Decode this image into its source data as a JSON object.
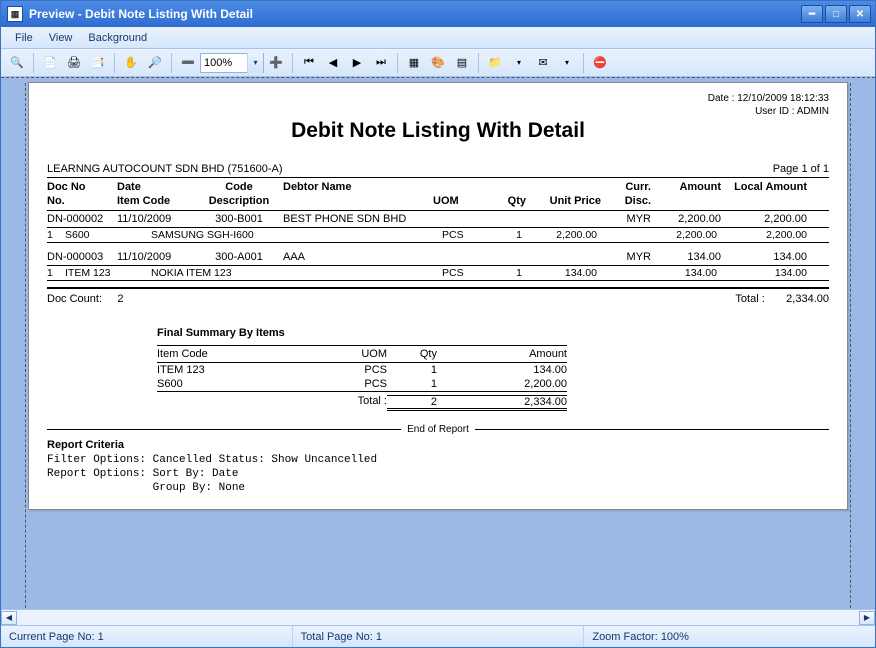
{
  "window": {
    "title": "Preview - Debit Note Listing With Detail"
  },
  "menu": {
    "file": "File",
    "view": "View",
    "background": "Background"
  },
  "toolbar": {
    "zoom_value": "100%"
  },
  "report": {
    "meta_date_label": "Date :",
    "meta_date": "12/10/2009 18:12:33",
    "meta_user_label": "User ID :",
    "meta_user": "ADMIN",
    "title": "Debit Note Listing With Detail",
    "org_name": "LEARNNG AUTOCOUNT SDN BHD (751600-A)",
    "page_label": "Page 1 of 1",
    "head": {
      "docno": "Doc No",
      "date": "Date",
      "code": "Code",
      "debtor": "Debtor Name",
      "curr": "Curr.",
      "amount": "Amount",
      "localamount": "Local Amount",
      "no": "No.",
      "itemcode": "Item Code",
      "description": "Description",
      "uom": "UOM",
      "qty": "Qty",
      "unitprice": "Unit Price",
      "disc": "Disc."
    },
    "docs": [
      {
        "docno": "DN-000002",
        "date": "11/10/2009",
        "code": "300-B001",
        "debtor": "BEST PHONE SDN BHD",
        "curr": "MYR",
        "amount": "2,200.00",
        "localamount": "2,200.00",
        "item_no": "1",
        "item_code": "S600",
        "item_desc": "SAMSUNG SGH-I600",
        "item_uom": "PCS",
        "item_qty": "1",
        "item_unitprice": "2,200.00",
        "item_disc": "",
        "item_amount": "2,200.00",
        "item_localamount": "2,200.00"
      },
      {
        "docno": "DN-000003",
        "date": "11/10/2009",
        "code": "300-A001",
        "debtor": "AAA",
        "curr": "MYR",
        "amount": "134.00",
        "localamount": "134.00",
        "item_no": "1",
        "item_code": "ITEM 123",
        "item_desc": "NOKIA ITEM 123",
        "item_uom": "PCS",
        "item_qty": "1",
        "item_unitprice": "134.00",
        "item_disc": "",
        "item_amount": "134.00",
        "item_localamount": "134.00"
      }
    ],
    "doccount_label": "Doc Count:",
    "doccount": "2",
    "total_label": "Total :",
    "total": "2,334.00",
    "summary": {
      "title": "Final Summary By Items",
      "head": {
        "itemcode": "Item Code",
        "uom": "UOM",
        "qty": "Qty",
        "amount": "Amount"
      },
      "rows": [
        {
          "itemcode": "ITEM 123",
          "uom": "PCS",
          "qty": "1",
          "amount": "134.00"
        },
        {
          "itemcode": "S600",
          "uom": "PCS",
          "qty": "1",
          "amount": "2,200.00"
        }
      ],
      "total_label": "Total :",
      "total_qty": "2",
      "total_amount": "2,334.00"
    },
    "eor": "End of Report",
    "criteria_title": "Report Criteria",
    "criteria_body": "Filter Options: Cancelled Status: Show Uncancelled\nReport Options: Sort By: Date\n                Group By: None"
  },
  "status": {
    "current_label": "Current Page No:",
    "current": "1",
    "total_label": "Total Page No:",
    "total": "1",
    "zoom_label": "Zoom Factor:",
    "zoom": "100%"
  }
}
